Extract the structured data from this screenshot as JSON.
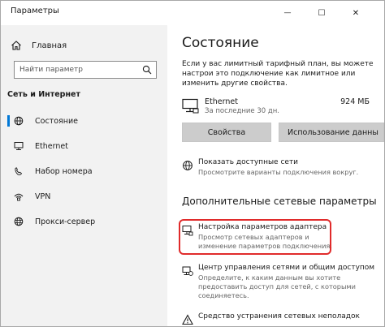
{
  "window": {
    "title": "Параметры",
    "minimize": "—",
    "maximize": "☐",
    "close": "✕"
  },
  "sidebar": {
    "home_label": "Главная",
    "search_placeholder": "Найти параметр",
    "section_title": "Сеть и Интернет",
    "items": [
      {
        "label": "Состояние",
        "icon": "status-globe-icon",
        "active": true
      },
      {
        "label": "Ethernet",
        "icon": "ethernet-monitor-icon",
        "active": false
      },
      {
        "label": "Набор номера",
        "icon": "dialup-phone-icon",
        "active": false
      },
      {
        "label": "VPN",
        "icon": "vpn-icon",
        "active": false
      },
      {
        "label": "Прокси-сервер",
        "icon": "proxy-globe-icon",
        "active": false
      }
    ]
  },
  "main": {
    "title": "Состояние",
    "notice": "Если у вас лимитный тарифный план, вы можете настрои это подключение как лимитное или изменить другие свойства.",
    "connection": {
      "name": "Ethernet",
      "subtitle": "За последние 30 дн.",
      "data_used": "924 МБ"
    },
    "buttons": {
      "properties": "Свойства",
      "data_usage": "Использование данны"
    },
    "show_networks": {
      "title": "Показать доступные сети",
      "subtitle": "Просмотрите варианты подключения вокруг."
    },
    "advanced_title": "Дополнительные сетевые параметры",
    "adapter_settings": {
      "title": "Настройка параметров адаптера",
      "subtitle": "Просмотр сетевых адаптеров и изменение параметров подключения."
    },
    "network_center": {
      "title": "Центр управления сетями и общим доступом",
      "subtitle": "Определите, к каким данным вы хотите предоставить доступ для сетей, с которыми соединяетесь."
    },
    "troubleshooter": {
      "title": "Средство устранения сетевых неполадок"
    }
  },
  "colors": {
    "accent": "#0078d7",
    "highlight": "#e02b2b",
    "sidebar_bg": "#f2f2f2",
    "button_bg": "#cccccc"
  }
}
